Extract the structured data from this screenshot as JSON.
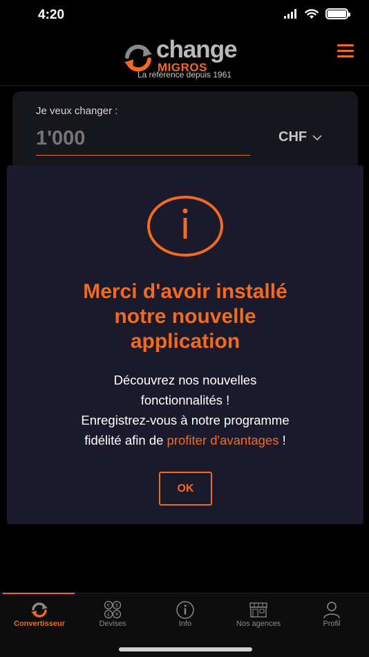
{
  "status_bar": {
    "time": "4:20"
  },
  "header": {
    "logo_change": "change",
    "logo_migros": "MIGROS",
    "tagline": "La référence depuis 1961"
  },
  "converter": {
    "label": "Je veux changer :",
    "amount_placeholder": "1'000",
    "currency": "CHF"
  },
  "modal": {
    "title_lines": [
      "Merci d'avoir installé",
      "notre nouvelle",
      "application"
    ],
    "body_line1": "Découvrez nos nouvelles",
    "body_line2": "fonctionnalités !",
    "body_line3": "Enregistrez-vous à notre programme",
    "body_line4_prefix": "fidélité afin de ",
    "body_link": "profiter d'avantages",
    "body_line4_suffix": " !",
    "ok_label": "OK"
  },
  "nav": {
    "items": [
      {
        "label": "Convertisseur",
        "icon": "exchange-icon",
        "active": true
      },
      {
        "label": "Devises",
        "icon": "currencies-icon",
        "active": false
      },
      {
        "label": "Info",
        "icon": "info-icon",
        "active": false
      },
      {
        "label": "Nos agences",
        "icon": "store-icon",
        "active": false
      },
      {
        "label": "Profil",
        "icon": "user-icon",
        "active": false
      }
    ]
  },
  "colors": {
    "accent": "#f26b1d",
    "modal_bg": "#1b1a2c",
    "card_bg": "#16161d"
  }
}
